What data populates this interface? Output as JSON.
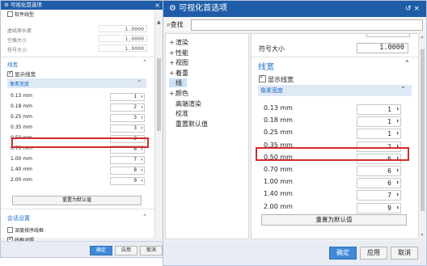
{
  "left": {
    "title": "可视化首选项",
    "close": "×",
    "top_checkbox": "软件线型",
    "fields": [
      {
        "label": "虚线周长度",
        "value": "1.0000"
      },
      {
        "label": "空格大小",
        "value": "1.0000"
      },
      {
        "label": "符号大小",
        "value": "1.0000"
      }
    ],
    "line_width_section": "线宽",
    "show_line_width": "显示线宽",
    "pixel_width_header": "像素宽度",
    "widths": [
      {
        "label": "0.13 mm",
        "value": "1"
      },
      {
        "label": "0.18 mm",
        "value": "2"
      },
      {
        "label": "0.25 mm",
        "value": "3"
      },
      {
        "label": "0.35 mm",
        "value": "3"
      },
      {
        "label": "0.50 mm",
        "value": "3"
      },
      {
        "label": "0.70 mm",
        "value": "6"
      },
      {
        "label": "1.00 mm",
        "value": "7"
      },
      {
        "label": "1.40 mm",
        "value": "8"
      },
      {
        "label": "2.00 mm",
        "value": "9"
      }
    ],
    "reset": "重置为默认值",
    "session_section": "会话设置",
    "session_checks": [
      {
        "label": "深度排序线框",
        "checked": false
      },
      {
        "label": "线框对照",
        "checked": true
      }
    ],
    "buttons": {
      "ok": "确定",
      "apply": "应用",
      "cancel": "取消"
    }
  },
  "right": {
    "title": "可视化首选项",
    "title_controls": "↺ ×",
    "find_label": "查找",
    "find_value": "",
    "tree": [
      {
        "label": "渲染",
        "expander": "+",
        "selected": false
      },
      {
        "label": "性能",
        "expander": "+",
        "selected": false
      },
      {
        "label": "视图",
        "expander": "+",
        "selected": false
      },
      {
        "label": "着重",
        "expander": "+",
        "selected": false
      },
      {
        "label": "线",
        "expander": "",
        "selected": true
      },
      {
        "label": "颜色",
        "expander": "+",
        "selected": false
      },
      {
        "label": "高端渲染",
        "expander": "",
        "selected": false
      },
      {
        "label": "校准",
        "expander": "",
        "selected": false
      },
      {
        "label": "重置默认值",
        "expander": "",
        "selected": false
      }
    ],
    "symbol_size_label": "符号大小",
    "symbol_size_value": "1.0000",
    "line_width_section": "线宽",
    "show_line_width": "显示线宽",
    "pixel_width_header": "像素宽度",
    "widths": [
      {
        "label": "0.13 mm",
        "value": "1"
      },
      {
        "label": "0.18 mm",
        "value": "1"
      },
      {
        "label": "0.25 mm",
        "value": "1"
      },
      {
        "label": "0.35 mm",
        "value": "2"
      },
      {
        "label": "0.50 mm",
        "value": "6"
      },
      {
        "label": "0.70 mm",
        "value": "6"
      },
      {
        "label": "1.00 mm",
        "value": "6"
      },
      {
        "label": "1.40 mm",
        "value": "7"
      },
      {
        "label": "2.00 mm",
        "value": "9"
      }
    ],
    "reset": "重置为默认值",
    "buttons": {
      "ok": "确定",
      "apply": "应用",
      "cancel": "取消"
    }
  },
  "colors": {
    "titlebar": "#1f5da8",
    "accent": "#1f6fc5",
    "highlight": "#d42a2a",
    "subheader": "#dfe8f5"
  }
}
